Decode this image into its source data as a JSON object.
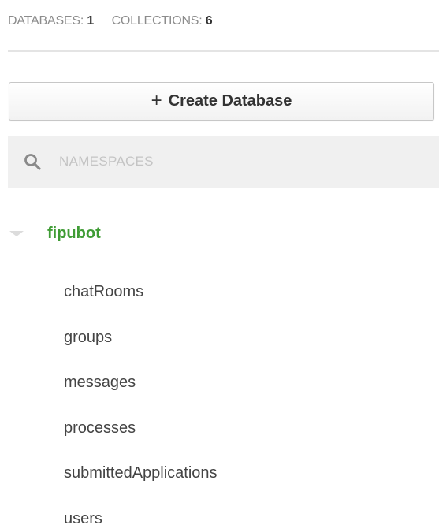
{
  "stats": {
    "databases_label": "DATABASES:",
    "databases_count": "1",
    "collections_label": "COLLECTIONS:",
    "collections_count": "6"
  },
  "create_button": {
    "icon": "plus-icon",
    "plus_glyph": "+",
    "label": "Create Database"
  },
  "search": {
    "icon": "search-icon",
    "placeholder": "NAMESPACES",
    "value": ""
  },
  "database": {
    "icon": "caret-down-icon",
    "name": "fipubot",
    "expanded": true,
    "name_color": "#3f9c35"
  },
  "collections": [
    "chatRooms",
    "groups",
    "messages",
    "processes",
    "submittedApplications",
    "users"
  ]
}
